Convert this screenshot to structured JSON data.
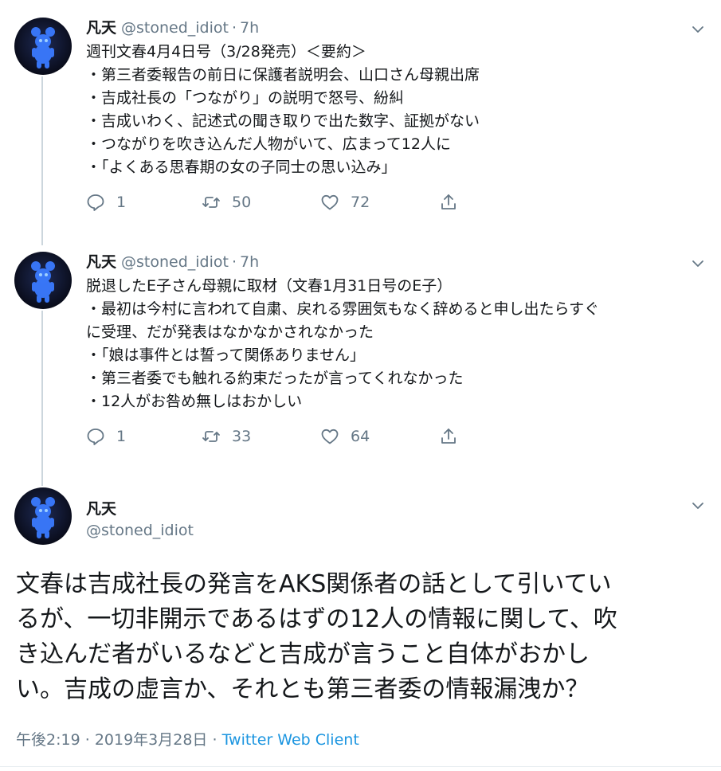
{
  "tweets": [
    {
      "name": "凡天",
      "handle": "@stoned_idiot",
      "separator": "·",
      "time": "7h",
      "lines": [
        "週刊文春4月4日号（3/28発売）＜要約＞",
        "・第三者委報告の前日に保護者説明会、山口さん母親出席",
        "・吉成社長の「つながり」の説明で怒号、紛糾",
        "・吉成いわく、記述式の聞き取りで出た数字、証拠がない",
        "・つながりを吹き込んだ人物がいて、広まって12人に",
        "・「よくある思春期の女の子同士の思い込み」"
      ],
      "replies": "1",
      "retweets": "50",
      "likes": "72"
    },
    {
      "name": "凡天",
      "handle": "@stoned_idiot",
      "separator": "·",
      "time": "7h",
      "lines": [
        "脱退したE子さん母親に取材（文春1月31日号のE子）",
        "・最初は今村に言われて自粛、戻れる雰囲気もなく辞めると申し出たらすぐ",
        "に受理、だが発表はなかなかされなかった",
        "・「娘は事件とは誓って関係ありません」",
        "・第三者委でも触れる約束だったが言ってくれなかった",
        "・12人がお咎め無しはおかしい"
      ],
      "replies": "1",
      "retweets": "33",
      "likes": "64"
    }
  ],
  "main_tweet": {
    "name": "凡天",
    "handle": "@stoned_idiot",
    "text_lines": [
      "文春は吉成社長の発言をAKS関係者の話として引いてい",
      "るが、一切非開示であるはずの12人の情報に関して、吹",
      "き込んだ者がいるなどと吉成が言うこと自体がおかし",
      "い。吉成の虚言か、それとも第三者委の情報漏洩か？"
    ],
    "time": "午後2:19",
    "separator1": "·",
    "date": "2019年3月28日",
    "separator2": "·",
    "client": "Twitter Web Client"
  },
  "icons": {
    "reply": "reply-icon",
    "retweet": "retweet-icon",
    "like": "heart-icon",
    "share": "share-icon",
    "more": "chevron-down-icon",
    "avatar": "avatar-image"
  },
  "colors": {
    "text": "#14171a",
    "secondary": "#657786",
    "link": "#1b95e0",
    "thread_line": "#ccd6dd"
  }
}
